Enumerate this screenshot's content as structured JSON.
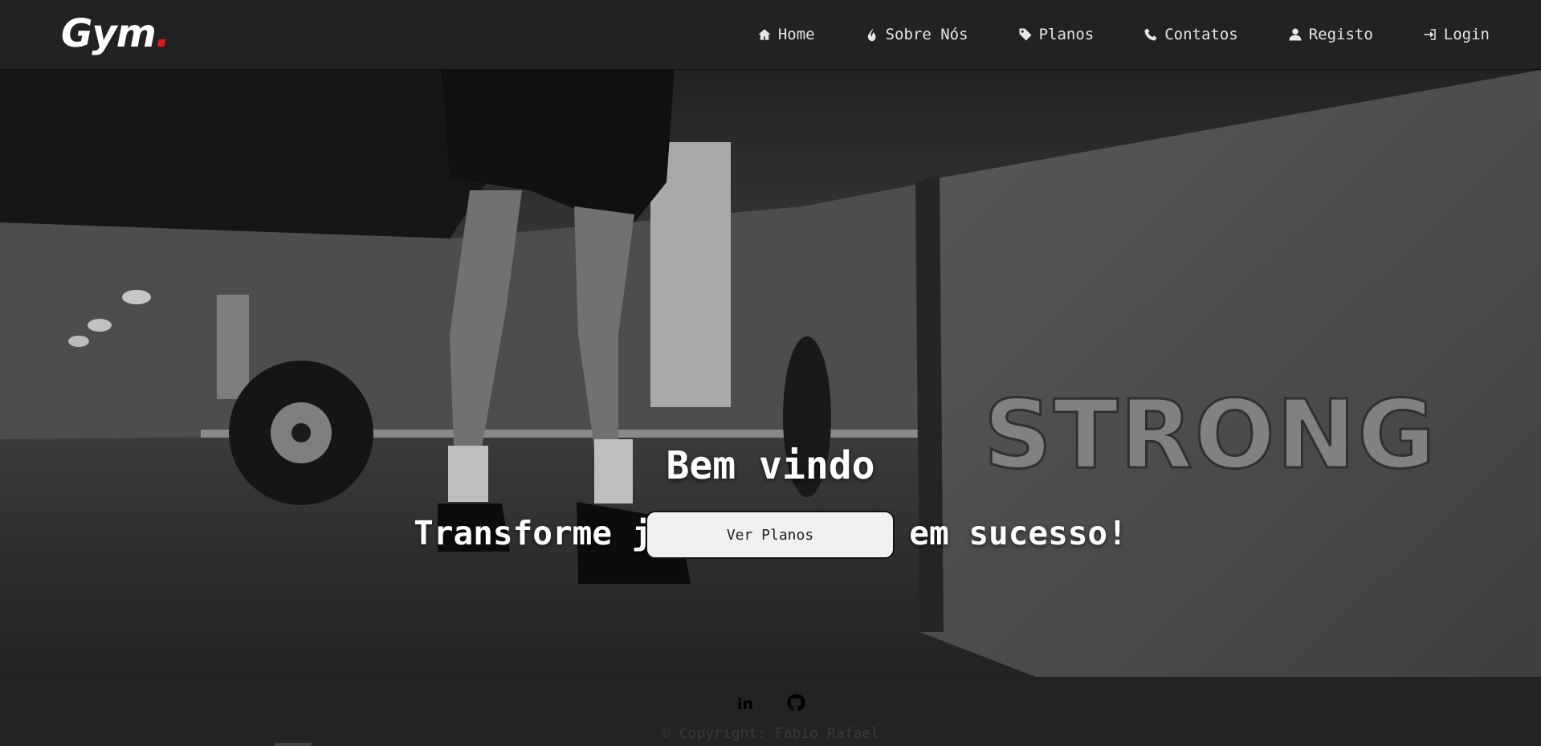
{
  "brand": {
    "name": "Gym",
    "dot": ".",
    "accent": "#e3171c"
  },
  "nav": {
    "items": [
      {
        "label": "Home",
        "icon": "home-icon"
      },
      {
        "label": "Sobre Nós",
        "icon": "fire-icon"
      },
      {
        "label": "Planos",
        "icon": "tag-icon"
      },
      {
        "label": "Contatos",
        "icon": "phone-icon"
      },
      {
        "label": "Registo",
        "icon": "user-icon"
      },
      {
        "label": "Login",
        "icon": "login-icon"
      }
    ]
  },
  "hero": {
    "title": "Bem vindo",
    "subtitle": "Transforme já o seu suor em sucesso!",
    "cta_label": "Ver Planos",
    "background_text": "STRONG"
  },
  "footer": {
    "social": [
      {
        "name": "linkedin",
        "icon": "linkedin-icon",
        "glyph": "in"
      },
      {
        "name": "github",
        "icon": "github-icon"
      }
    ],
    "copyright": "© Copyright: Fábio Rafael"
  }
}
